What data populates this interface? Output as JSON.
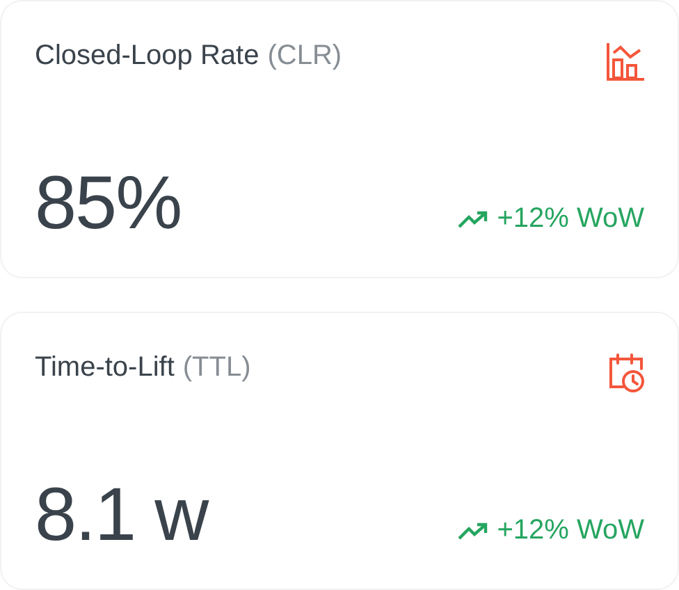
{
  "metrics": [
    {
      "name": "Closed-Loop Rate",
      "abbreviation": "(CLR)",
      "value": "85%",
      "trend": "+12% WoW"
    },
    {
      "name": "Time-to-Lift",
      "abbreviation": "(TTL)",
      "value": "8.1 w",
      "trend": "+12% WoW"
    }
  ]
}
